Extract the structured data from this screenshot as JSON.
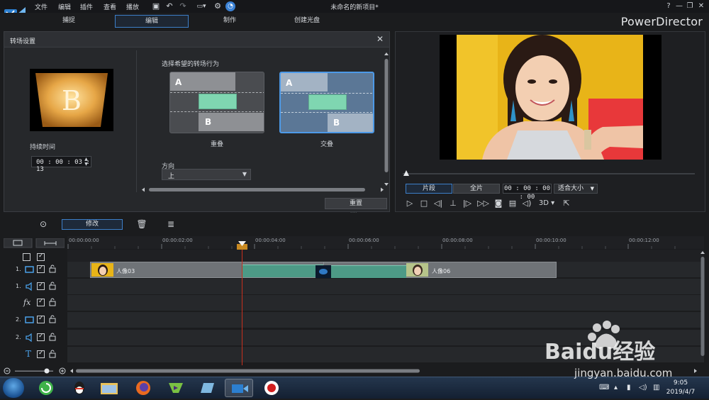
{
  "app": {
    "menu": [
      "文件",
      "编辑",
      "插件",
      "查看",
      "播放"
    ],
    "doc_title": "未命名的新项目*",
    "brand": "PowerDirector",
    "window_controls": {
      "help": "?",
      "minimize": "—",
      "restore": "❐",
      "close": "✕"
    }
  },
  "modes": [
    {
      "label": "捕捉",
      "active": false
    },
    {
      "label": "编辑",
      "active": true
    },
    {
      "label": "制作",
      "active": false
    },
    {
      "label": "创建光盘",
      "active": false
    }
  ],
  "transition_panel": {
    "title": "转场设置",
    "thumb_letter": "B",
    "duration_label": "持续时间",
    "duration_value": "00 : 00 : 03 : 13",
    "behavior_label": "选择希望的转场行为",
    "options": [
      {
        "label": "重叠",
        "selected": false,
        "a": "A",
        "b": "B"
      },
      {
        "label": "交叠",
        "selected": true,
        "a": "A",
        "b": "B"
      }
    ],
    "direction_label": "方向",
    "direction_value": "上",
    "reset_label": "重置"
  },
  "preview": {
    "tabs": [
      {
        "label": "片段",
        "active": true
      },
      {
        "label": "全片",
        "active": false
      }
    ],
    "timecode": "00 : 00 : 00 : 00",
    "fit_label": "适合大小",
    "controls": [
      "play-icon",
      "stop-icon",
      "prev-frame-icon",
      "split-icon",
      "next-frame-icon",
      "fast-forward-icon",
      "snapshot-icon",
      "subtitle-icon",
      "volume-icon",
      "3d-icon",
      "detach-icon"
    ],
    "mode_3d": "3D"
  },
  "timeline": {
    "modify_label": "修改",
    "ruler_ticks": [
      "00:00:00:00",
      "00:00:02:00",
      "00:00:04:00",
      "00:00:06:00",
      "00:00:08:00",
      "00:00:10:00",
      "00:00:12:00"
    ],
    "tracks": [
      {
        "num": "",
        "type": "master"
      },
      {
        "num": "1.",
        "type": "video"
      },
      {
        "num": "1.",
        "type": "audio"
      },
      {
        "num": "",
        "type": "fx"
      },
      {
        "num": "2.",
        "type": "video"
      },
      {
        "num": "2.",
        "type": "audio"
      },
      {
        "num": "",
        "type": "title"
      }
    ],
    "clips": [
      {
        "label": "人像03"
      },
      {
        "label": "人像06"
      }
    ]
  },
  "taskbar": {
    "apps": [
      "360-browser",
      "qq",
      "file-explorer",
      "firefox",
      "media-player",
      "notebook",
      "powerdirector",
      "recorder"
    ],
    "time": "9:05",
    "date": "2019/4/7"
  },
  "watermark": {
    "text": "Baidu经验",
    "url": "jingyan.baidu.com"
  },
  "colors": {
    "accent": "#3d7fc9",
    "playhead": "#c7301e",
    "transition": "#6fcaa6"
  }
}
